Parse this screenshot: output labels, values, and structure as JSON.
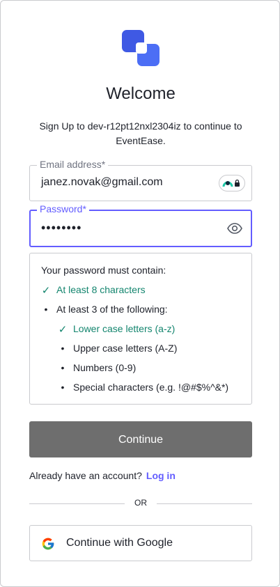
{
  "brand": {
    "logo_icon": "overlapping-squares-icon",
    "accent_color": "#635dff",
    "logo_color": "#3f59e4"
  },
  "header": {
    "title": "Welcome",
    "subtitle": "Sign Up to dev-r12pt12nxl2304iz to continue to EventEase."
  },
  "email": {
    "label": "Email address*",
    "value": "janez.novak@gmail.com",
    "badge_icon": "password-manager-icon"
  },
  "password": {
    "label": "Password*",
    "value": "••••••••",
    "toggle_icon": "eye-icon"
  },
  "requirements": {
    "heading": "Your password must contain:",
    "items": [
      {
        "text": "At least 8 characters",
        "met": true,
        "level": 0
      },
      {
        "text": "At least 3 of the following:",
        "met": false,
        "level": 0
      },
      {
        "text": "Lower case letters (a-z)",
        "met": true,
        "level": 1
      },
      {
        "text": "Upper case letters (A-Z)",
        "met": false,
        "level": 1
      },
      {
        "text": "Numbers (0-9)",
        "met": false,
        "level": 1
      },
      {
        "text": "Special characters (e.g. !@#$%^&*)",
        "met": false,
        "level": 1
      }
    ],
    "check_mark": "✓",
    "bullet_mark": "•"
  },
  "actions": {
    "continue_label": "Continue",
    "login_prompt": "Already have an account?",
    "login_link": "Log in",
    "divider_text": "OR",
    "google_label": "Continue with Google"
  }
}
